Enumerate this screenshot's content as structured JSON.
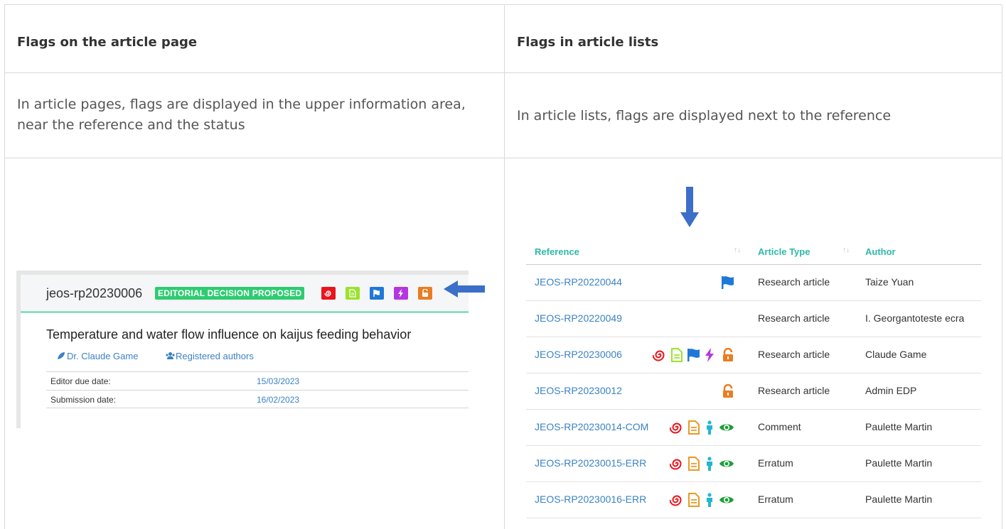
{
  "headers": {
    "left": "Flags on the article page",
    "right": "Flags in article lists"
  },
  "descriptions": {
    "left": "In article pages, flags are displayed in the upper information area, near the reference and the status",
    "right": "In article lists, flags are displayed next to the reference"
  },
  "article_page": {
    "reference": "jeos-rp20230006",
    "status": "EDITORIAL DECISION PROPOSED",
    "flags": [
      {
        "icon": "spiral-icon",
        "color": "#e8141c"
      },
      {
        "icon": "document-icon",
        "color": "#9be22d"
      },
      {
        "icon": "flag-icon",
        "color": "#1f78d8"
      },
      {
        "icon": "lightning-icon",
        "color": "#b536e0"
      },
      {
        "icon": "unlock-icon",
        "color": "#ea7c22"
      }
    ],
    "title": "Temperature and water flow influence on kaijus feeding behavior",
    "author": "Dr. Claude Game",
    "registered_authors": "Registered authors",
    "editor_due_label": "Editor due date:",
    "editor_due_value": "15/03/2023",
    "submission_label": "Submission date:",
    "submission_value": "16/02/2023"
  },
  "article_list": {
    "columns": {
      "reference": "Reference",
      "type": "Article Type",
      "author": "Author",
      "sort": "↑↓"
    },
    "rows": [
      {
        "reference": "JEOS-RP20220044",
        "type": "Research article",
        "author": "Taize Yuan",
        "flags": [
          "flag-icon"
        ]
      },
      {
        "reference": "JEOS-RP20220049",
        "type": "Research article",
        "author": "I. Georgantoteste ecra",
        "flags": []
      },
      {
        "reference": "JEOS-RP20230006",
        "type": "Research article",
        "author": "Claude Game",
        "flags": [
          "spiral-icon",
          "document-icon",
          "flag-icon",
          "lightning-icon",
          "unlock-icon"
        ]
      },
      {
        "reference": "JEOS-RP20230012",
        "type": "Research article",
        "author": "Admin EDP",
        "flags": [
          "unlock-icon"
        ]
      },
      {
        "reference": "JEOS-RP20230014-COM",
        "type": "Comment",
        "author": "Paulette Martin",
        "flags": [
          "spiral-icon",
          "document-icon",
          "person-icon",
          "eye-icon"
        ]
      },
      {
        "reference": "JEOS-RP20230015-ERR",
        "type": "Erratum",
        "author": "Paulette Martin",
        "flags": [
          "spiral-icon",
          "document-icon",
          "person-icon",
          "eye-icon"
        ]
      },
      {
        "reference": "JEOS-RP20230016-ERR",
        "type": "Erratum",
        "author": "Paulette Martin",
        "flags": [
          "spiral-icon",
          "document-icon",
          "person-icon",
          "eye-icon"
        ]
      }
    ]
  },
  "colors": {
    "link": "#3b82c4",
    "status_green": "#2ecc71",
    "header_teal": "#2db9a8",
    "arrow_blue": "#3b6fc9"
  }
}
